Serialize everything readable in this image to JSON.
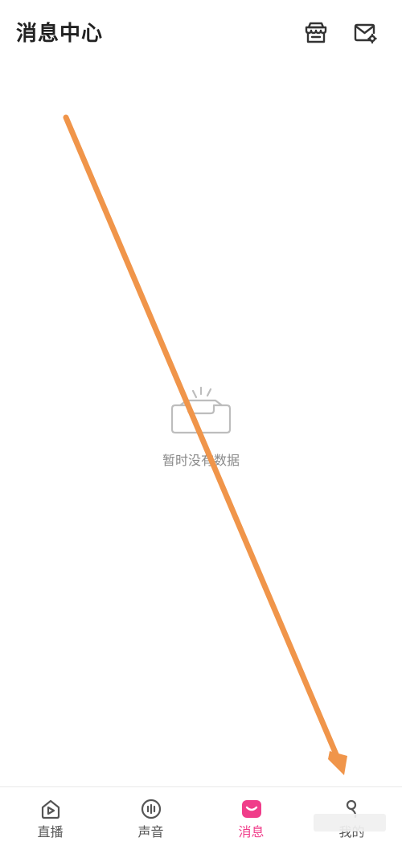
{
  "header": {
    "title": "消息中心",
    "icons": [
      "store-icon",
      "mail-settings-icon"
    ]
  },
  "empty_state": {
    "message": "暂时没有数据",
    "icon": "empty-inbox-icon"
  },
  "tabbar": {
    "tabs": [
      {
        "label": "直播",
        "icon": "home-play-icon",
        "active": false
      },
      {
        "label": "声音",
        "icon": "voice-icon",
        "active": false
      },
      {
        "label": "消息",
        "icon": "message-icon",
        "active": true
      },
      {
        "label": "我的",
        "icon": "profile-icon",
        "active": false
      }
    ]
  },
  "colors": {
    "accent": "#f03d8a",
    "arrow": "#f0954a",
    "text_primary": "#222222",
    "text_muted": "#8a8a8a"
  }
}
